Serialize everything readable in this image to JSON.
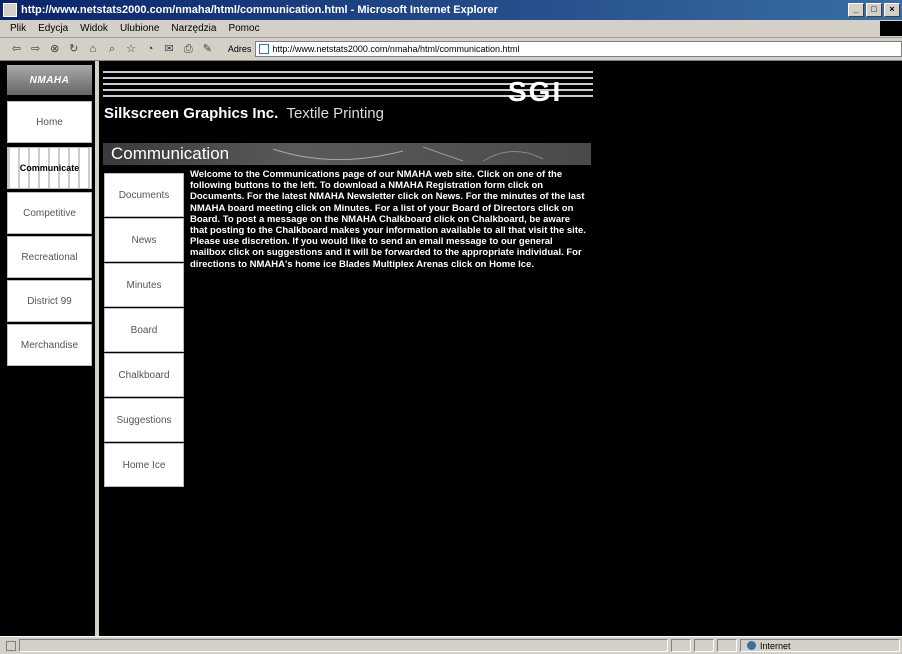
{
  "window": {
    "title": "http://www.netstats2000.com/nmaha/html/communication.html - Microsoft Internet Explorer",
    "controls": [
      "_",
      "□",
      "×"
    ]
  },
  "menu": [
    "Plik",
    "Edycja",
    "Widok",
    "Ulubione",
    "Narzędzia",
    "Pomoc"
  ],
  "toolbar": {
    "icons": [
      "back-icon",
      "forward-icon",
      "stop-icon",
      "refresh-icon",
      "home-icon",
      "search-icon",
      "favorites-icon",
      "history-icon",
      "mail-icon",
      "print-icon",
      "edit-icon"
    ],
    "address_label": "Adres",
    "address_value": "http://www.netstats2000.com/nmaha/html/communication.html"
  },
  "site": {
    "logo_text": "NMAHA",
    "sgi_logo": "SGI",
    "brand_name": "Silkscreen Graphics Inc.",
    "brand_tagline": "Textile Printing",
    "section_title": "Communication",
    "left_nav": [
      "Home",
      "Communicate",
      "Competitive",
      "Recreational",
      "District 99",
      "Merchandise"
    ],
    "active_left_nav": "Communicate",
    "sub_nav": [
      "Documents",
      "News",
      "Minutes",
      "Board",
      "Chalkboard",
      "Suggestions",
      "Home Ice"
    ],
    "intro_text": "Welcome to the Communications page of our NMAHA web site. Click on one of the following buttons to the left. To download a NMAHA Registration form click on Documents. For the latest NMAHA Newsletter click on News. For the minutes of the last NMAHA board meeting click on Minutes. For a list of your Board of Directors click on Board. To post a message on the NMAHA Chalkboard click on Chalkboard, be aware that posting to the Chalkboard makes your information available to all that visit the site. Please use discretion. If you would like to send an email message to our general mailbox click on suggestions and it will be forwarded to the appropriate individual. For directions to NMAHA's home ice Blades Multiplex Arenas click on Home Ice."
  },
  "status": {
    "zone": "Internet"
  }
}
